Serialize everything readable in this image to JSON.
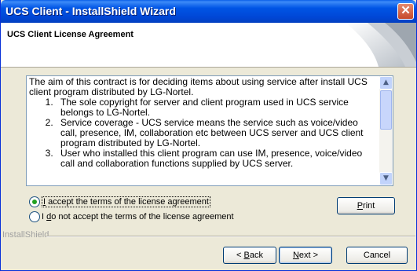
{
  "window": {
    "title": "UCS Client - InstallShield Wizard",
    "close_glyph": "✕"
  },
  "header": {
    "title": "UCS Client License Agreement"
  },
  "license": {
    "intro": "The aim of this contract is for deciding items about using service after install UCS client program distributed by LG-Nortel.",
    "items": [
      "The sole copyright for server and client program used in UCS service belongs to LG-Nortel.",
      "Service coverage - UCS service means the service such as voice/video call, presence, IM, collaboration etc between UCS server and UCS client program distributed by LG-Nortel.",
      "User who installed this client program can use IM, presence, voice/video call and collaboration functions supplied by UCS server."
    ]
  },
  "options": {
    "accept": {
      "prefix": "I",
      "rest": " accept the terms of the license agreement",
      "selected": true
    },
    "decline": {
      "prefix": "I ",
      "underline": "d",
      "rest": "o not accept the terms of the license agreement",
      "selected": false
    }
  },
  "buttons": {
    "print": {
      "underline": "P",
      "rest": "rint"
    },
    "back": {
      "prefix": "< ",
      "underline": "B",
      "rest": "ack"
    },
    "next": {
      "underline": "N",
      "rest": "ext >"
    },
    "cancel": "Cancel"
  },
  "footer": {
    "brand": "InstallShield"
  },
  "icons": {
    "scroll_up": "▲",
    "scroll_down": "▼"
  }
}
